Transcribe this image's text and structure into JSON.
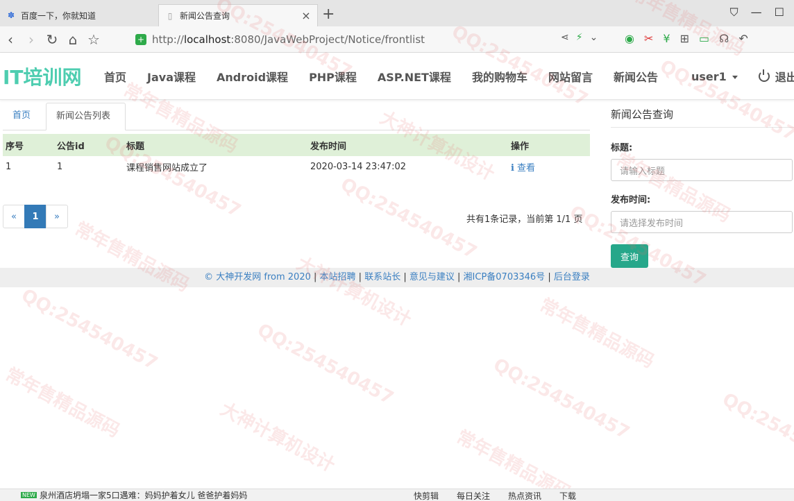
{
  "browser": {
    "tabs": [
      {
        "label": "百度一下，你就知道",
        "icon": "paw-icon"
      },
      {
        "label": "新闻公告查询",
        "icon": "page-icon"
      }
    ],
    "url_prefix": "http://",
    "url_host": "localhost",
    "url_rest": ":8080/JavaWebProject/Notice/frontlist"
  },
  "site": {
    "brand": "IT培训网",
    "menu": [
      "首页",
      "Java课程",
      "Android课程",
      "PHP课程",
      "ASP.NET课程",
      "我的购物车",
      "网站留言",
      "新闻公告"
    ],
    "user": "user1",
    "logout": "退出"
  },
  "breadcrumb_tabs": [
    "首页",
    "新闻公告列表"
  ],
  "table": {
    "headers": [
      "序号",
      "公告id",
      "标题",
      "发布时间",
      "操作"
    ],
    "rows": [
      {
        "no": "1",
        "id": "1",
        "title": "课程销售网站成立了",
        "time": "2020-03-14 23:47:02",
        "action": "查看"
      }
    ]
  },
  "pagination": {
    "prev": "«",
    "current": "1",
    "next": "»",
    "summary": "共有1条记录，当前第 1/1 页"
  },
  "sidebar": {
    "title": "新闻公告查询",
    "title_label": "标题:",
    "title_placeholder": "请输入标题",
    "time_label": "发布时间:",
    "time_placeholder": "请选择发布时间",
    "query_button": "查询"
  },
  "footer": {
    "copyright": "© 大神开发网 from 2020",
    "links": [
      "本站招聘",
      "联系站长",
      "意见与建议",
      "湘ICP备0703346号",
      "后台登录"
    ]
  },
  "statusbar": {
    "badge": "NEW",
    "news": "泉州酒店坍塌一家5口遇难：妈妈护着女儿 爸爸护着妈妈",
    "items": [
      "快剪辑",
      "每日关注",
      "热点资讯",
      "下载"
    ]
  },
  "watermark": {
    "lines": [
      "QQ:254540457",
      "常年售精品源码",
      "大神计算机设计"
    ]
  }
}
